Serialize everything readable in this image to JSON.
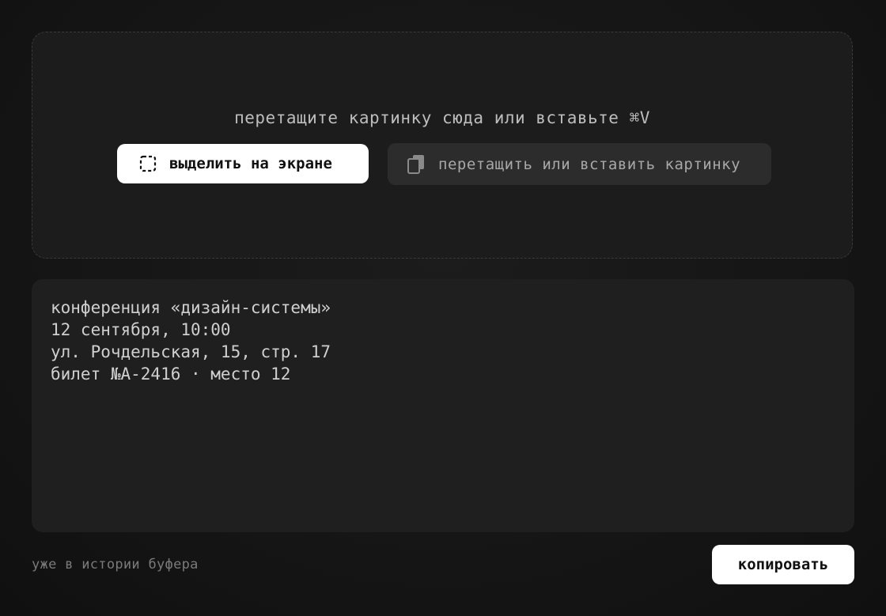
{
  "dropzone": {
    "hint": "перетащите картинку сюда или вставьте ⌘V",
    "select_button": {
      "label": "выделить на экране",
      "icon": "selection-icon"
    },
    "paste_button": {
      "label": "перетащить или вставить картинку",
      "icon": "clipboard-icon"
    }
  },
  "result": {
    "lines": [
      "конференция «дизайн-системы»",
      "12 сентября, 10:00",
      "ул. Рочдельская, 15, стр. 17",
      "билет №А-2416 · место 12"
    ]
  },
  "footer": {
    "status": "уже в истории буфера",
    "copy_label": "копировать"
  },
  "colors": {
    "background": "#141414",
    "panel": "#1f1f1f",
    "primary_button": "#ffffff",
    "secondary_button": "#2c2c2c"
  }
}
